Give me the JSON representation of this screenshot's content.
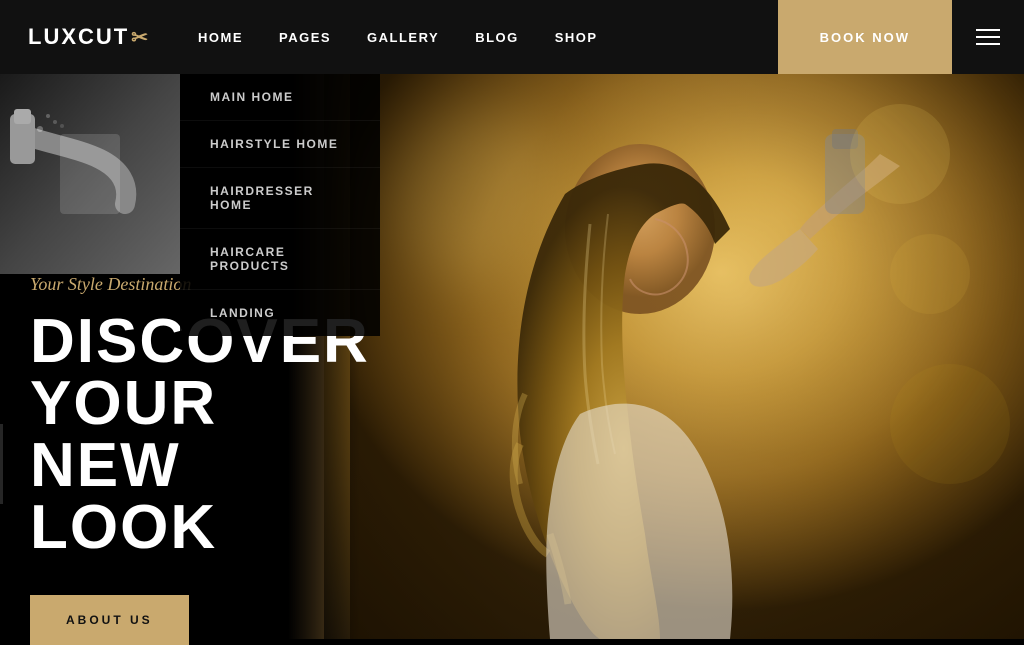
{
  "header": {
    "logo": "LUXCUT",
    "logo_icon": "✂",
    "nav": {
      "items": [
        {
          "label": "HOME",
          "id": "home",
          "active": true
        },
        {
          "label": "PAGES",
          "id": "pages"
        },
        {
          "label": "GALLERY",
          "id": "gallery"
        },
        {
          "label": "BLOG",
          "id": "blog"
        },
        {
          "label": "SHOP",
          "id": "shop"
        }
      ]
    },
    "book_now": "BOOK NOW"
  },
  "dropdown": {
    "items": [
      {
        "label": "MAIN HOME"
      },
      {
        "label": "HAIRSTYLE HOME"
      },
      {
        "label": "HAIRDRESSER HOME"
      },
      {
        "label": "HAIRCARE PRODUCTS"
      },
      {
        "label": "LANDING"
      }
    ]
  },
  "hero": {
    "tagline": "Your Style Destination",
    "title_line1": "DISCOVER",
    "title_line2": "YOUR",
    "title_line3": "NEW",
    "title_line4": "LOOK",
    "cta_button": "ABOUT US"
  },
  "colors": {
    "accent": "#c9a96e",
    "background": "#000",
    "header_bg": "#111",
    "text_primary": "#ffffff",
    "dropdown_bg": "rgba(0,0,0,0.88)"
  }
}
